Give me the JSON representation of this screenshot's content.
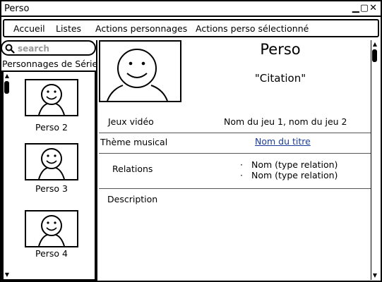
{
  "window": {
    "title": "Perso",
    "controls": "▁▢✕"
  },
  "menu": {
    "items": [
      "Accueil",
      "Listes",
      "Actions personnages",
      "Actions perso sélectionné"
    ]
  },
  "sidebar": {
    "search_placeholder": "search",
    "heading": "Personnages de Série",
    "characters": [
      "Perso 2",
      "Perso 3",
      "Perso 4"
    ]
  },
  "detail": {
    "name": "Perso",
    "quote": "\"Citation\"",
    "games_label": "Jeux vidéo",
    "games_value": "Nom du jeu 1, nom du jeu 2",
    "theme_label": "Thème musical",
    "theme_value": "Nom du titre",
    "relations_label": "Relations",
    "relations": [
      "Nom (type relation)",
      "Nom (type relation)"
    ],
    "description_label": "Description"
  },
  "icons": {
    "search": "search-icon",
    "window_controls": [
      "minimize-icon",
      "maximize-icon",
      "close-icon"
    ],
    "scroll": [
      "scroll-up-icon",
      "scroll-down-icon"
    ]
  }
}
